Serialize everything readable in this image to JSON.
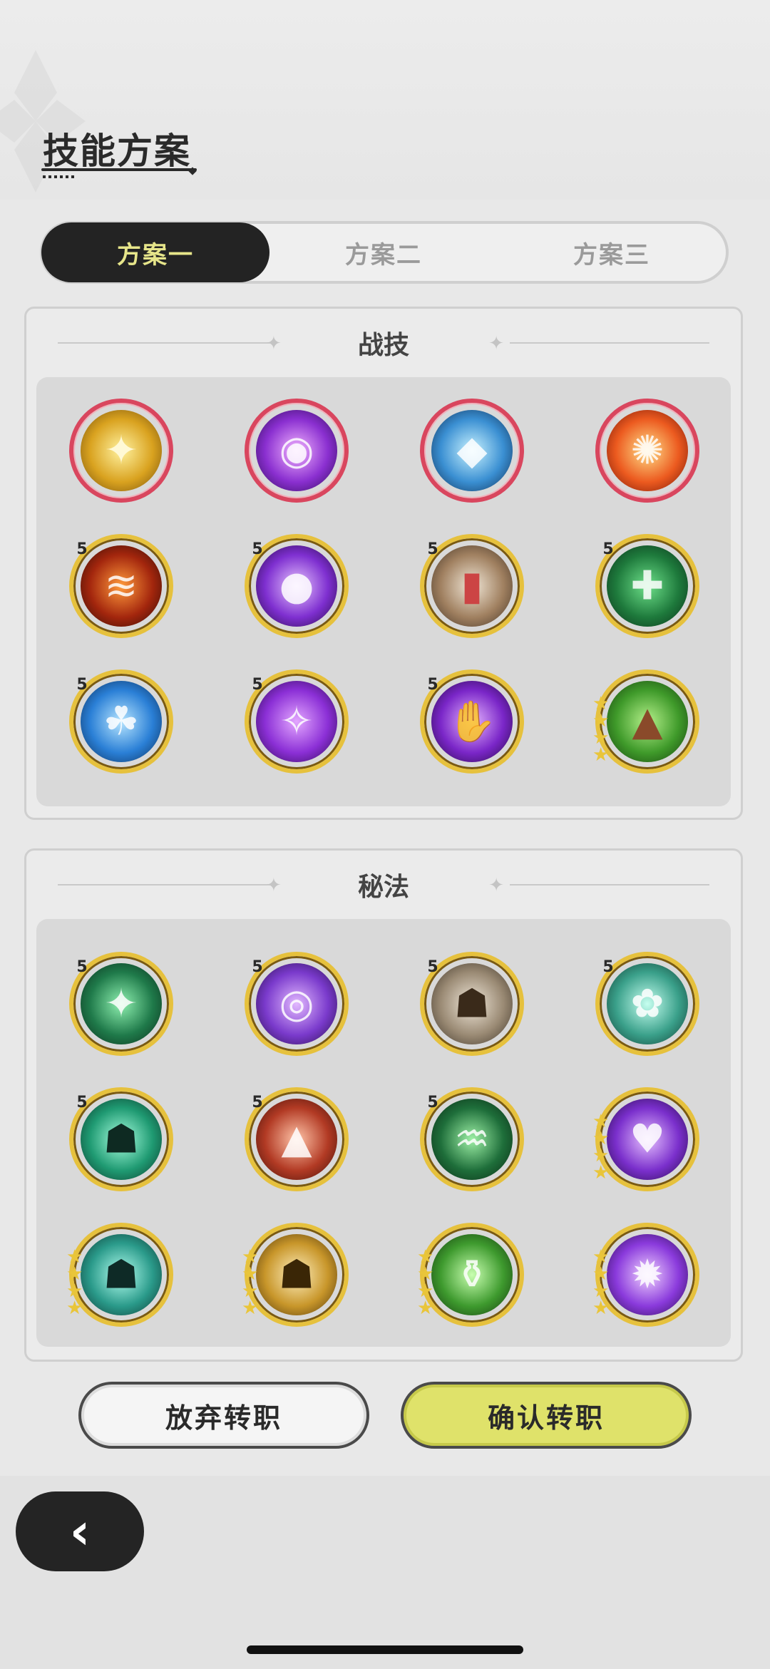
{
  "header": {
    "title": "技能方案"
  },
  "tabs": [
    {
      "label": "方案一",
      "active": true
    },
    {
      "label": "方案二",
      "active": false
    },
    {
      "label": "方案三",
      "active": false
    }
  ],
  "panels": {
    "combat": {
      "title": "战技"
    },
    "secret": {
      "title": "秘法"
    }
  },
  "badges": {
    "five": "5"
  },
  "buttons": {
    "cancel": "放弃转职",
    "confirm": "确认转职"
  },
  "icons": {
    "back": "back-arrow-icon",
    "combat_row1": [
      "golden-sparkle",
      "purple-eye",
      "ice-crystal",
      "fire-swirl"
    ],
    "combat_row2": [
      "flame-wave",
      "purple-orb",
      "stone-tablets",
      "green-healing"
    ],
    "combat_row3": [
      "blue-creature",
      "purple-star",
      "purple-hand",
      "tree-stump"
    ]
  },
  "colors": {
    "tab_active_bg": "#232323",
    "tab_active_text": "#e6e58a",
    "confirm_bg": "#dfe26a",
    "ring_red": "#d9465e",
    "ring_gold": "#e6c13d"
  }
}
